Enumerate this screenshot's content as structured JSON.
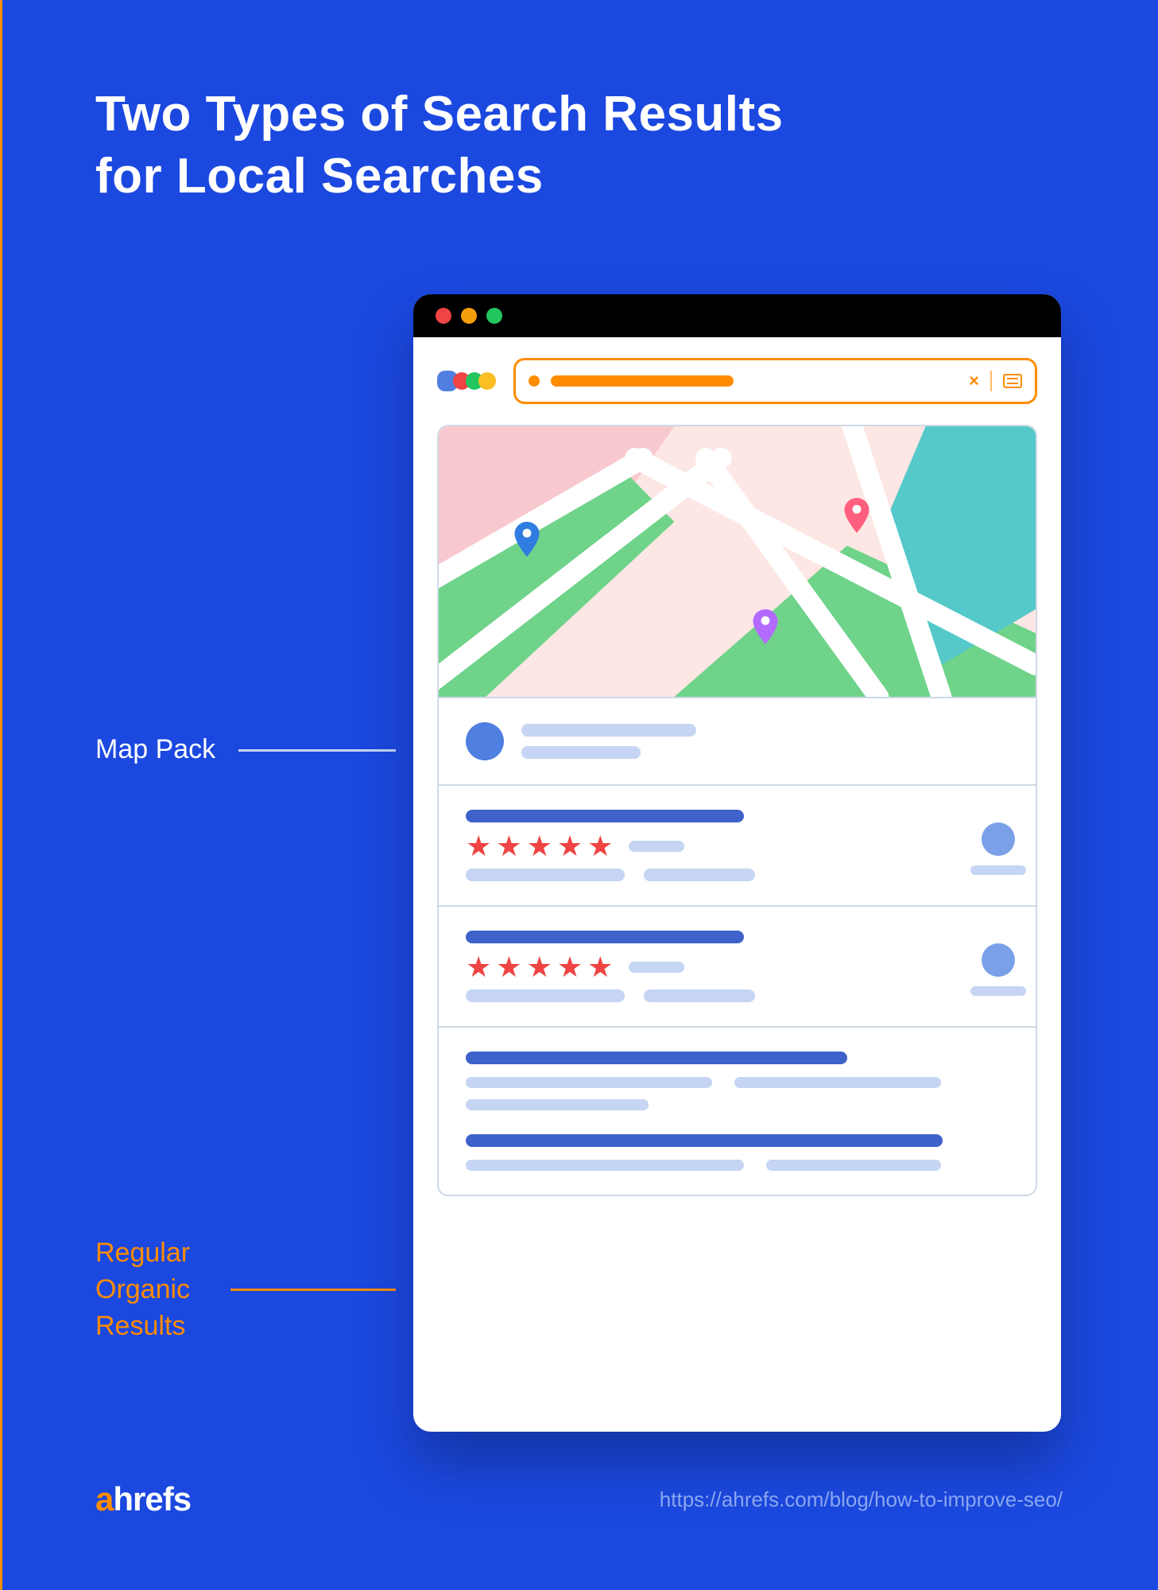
{
  "title_line1": "Two Types of Search Results",
  "title_line2": "for Local Searches",
  "callouts": {
    "map_pack": "Map Pack",
    "organic_line1": "Regular",
    "organic_line2": "Organic",
    "organic_line3": "Results"
  },
  "brand": {
    "a": "a",
    "rest": "hrefs"
  },
  "source_url": "https://ahrefs.com/blog/how-to-improve-seo/",
  "icons": {
    "close": "×"
  },
  "colors": {
    "bg": "#1b48df",
    "accent": "#ff8c00",
    "bar_dark": "#3e62c9",
    "bar_light": "#c5d5f3",
    "star": "#ef4444"
  }
}
